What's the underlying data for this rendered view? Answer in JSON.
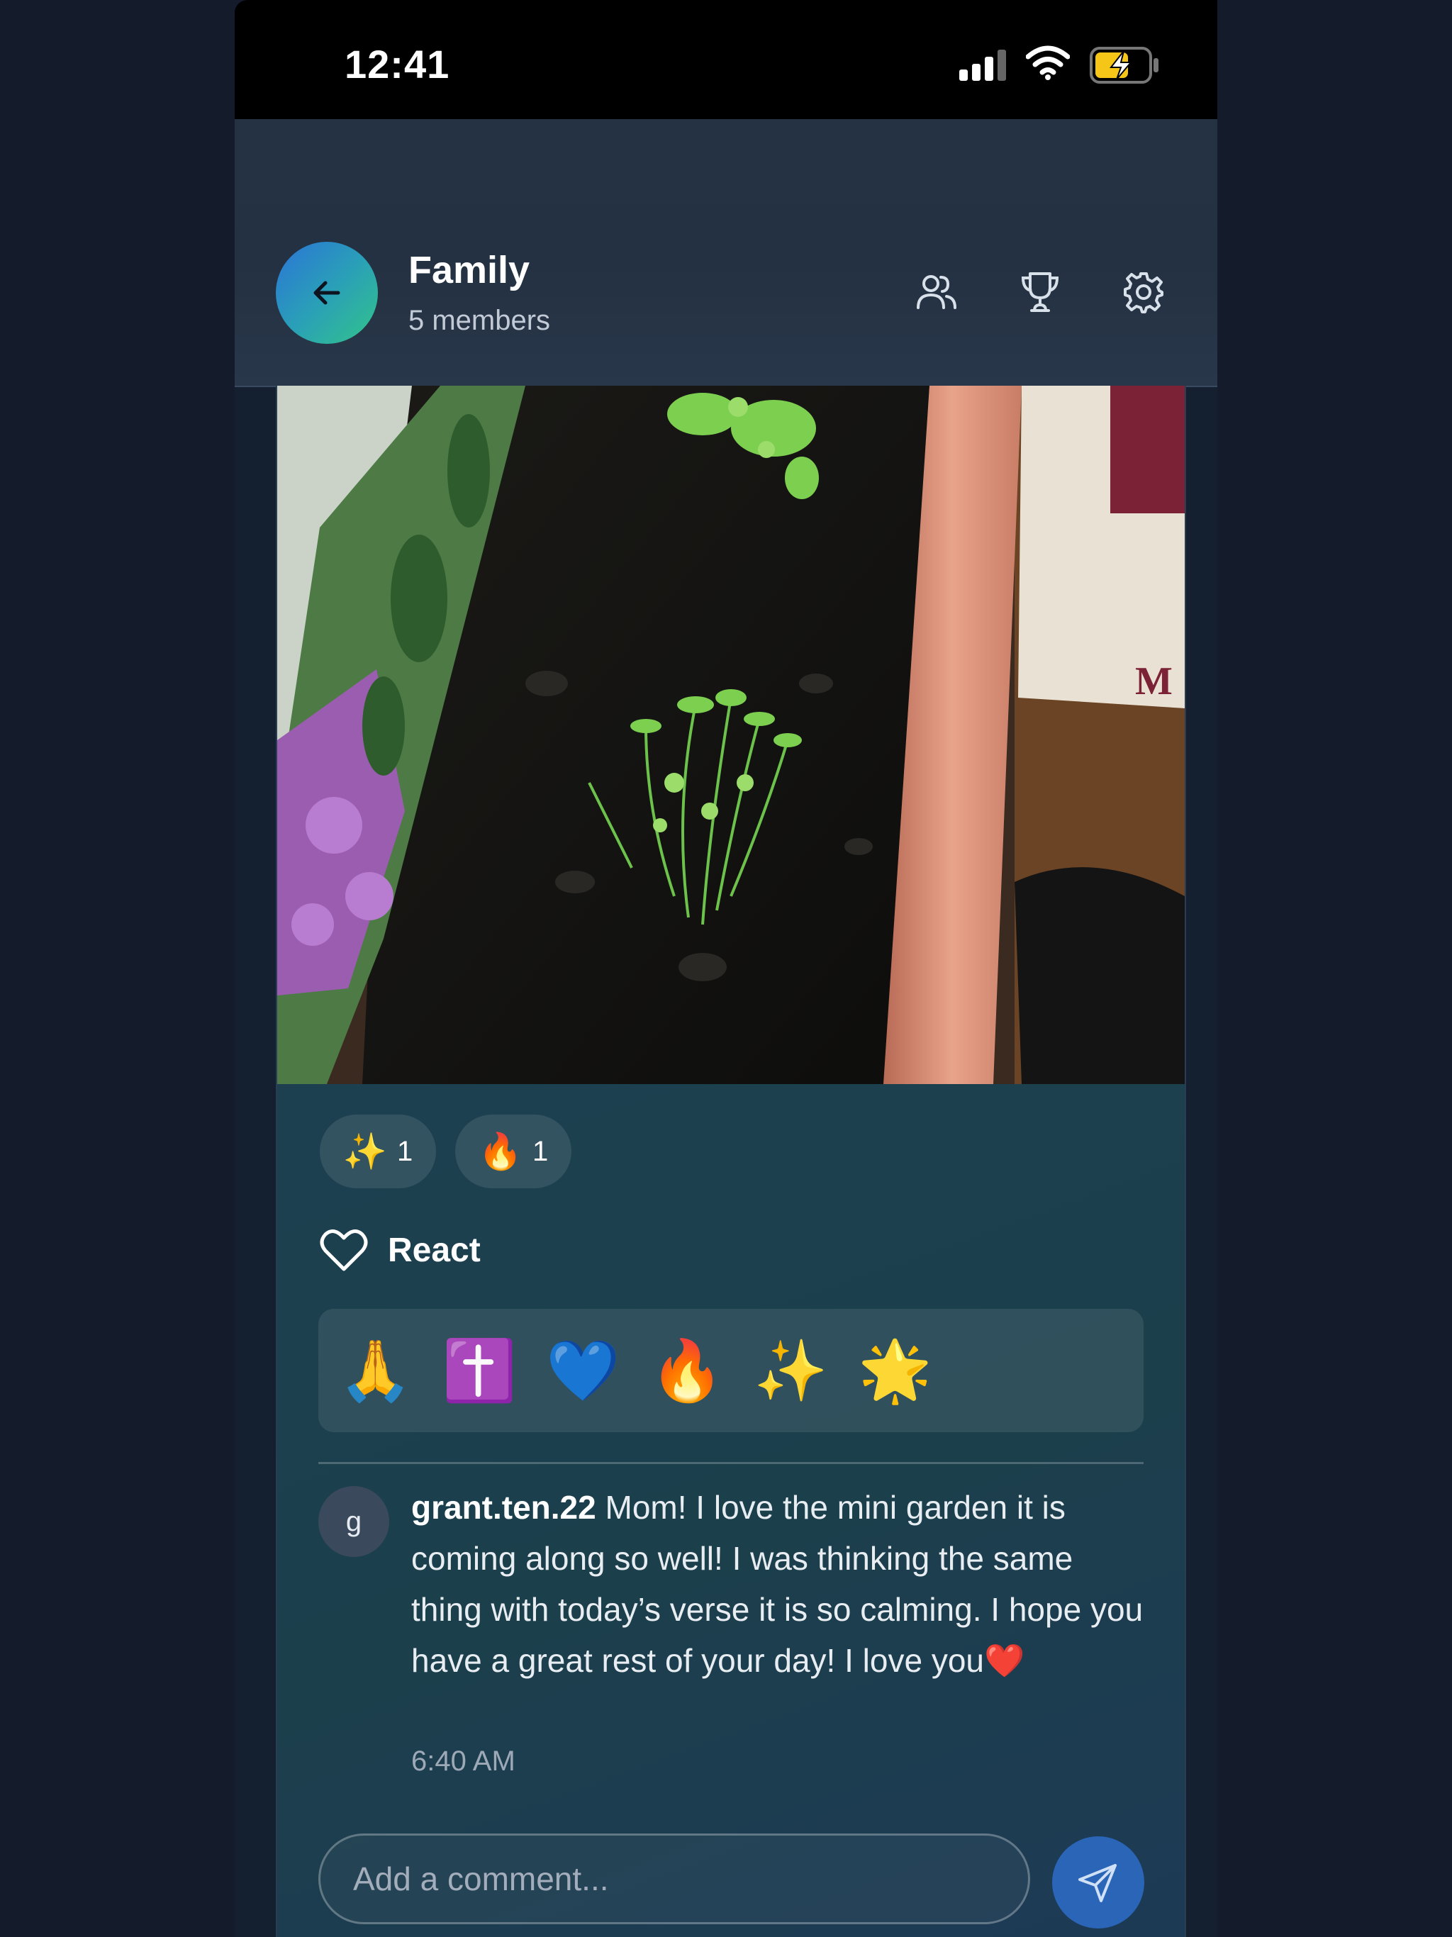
{
  "status_bar": {
    "time": "12:41"
  },
  "header": {
    "title": "Family",
    "subtitle": "5 members",
    "icons": [
      "members-icon",
      "trophy-icon",
      "gear-icon"
    ]
  },
  "post": {
    "image_description": "",
    "reactions": [
      {
        "emoji": "✨",
        "count": "1"
      },
      {
        "emoji": "🔥",
        "count": "1"
      }
    ],
    "react_label": "React",
    "emoji_picker": [
      "🙏",
      "✝️",
      "💙",
      "🔥",
      "✨",
      "🌟"
    ],
    "comments": [
      {
        "avatar_letter": "g",
        "username": "grant.ten.22",
        "text": " Mom! I love the mini garden it is coming along so well! I was thinking the same thing with today’s verse it is so calming. I hope you have a great rest of your day! I love you❤️",
        "time": "6:40 AM"
      }
    ]
  },
  "comment_input": {
    "placeholder": "Add a comment..."
  },
  "colors": {
    "accent": "#2a65b8",
    "back_gradient": [
      "#2b74d6",
      "#32c48a"
    ]
  }
}
